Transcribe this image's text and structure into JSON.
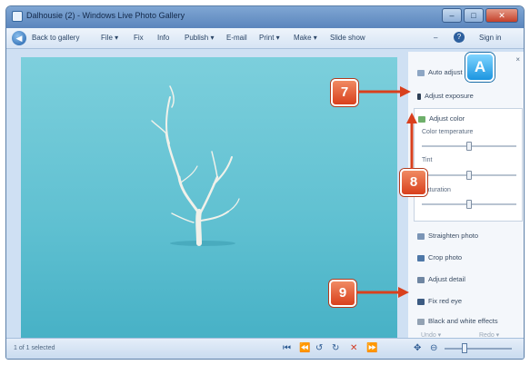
{
  "window": {
    "title": "Dalhousie (2) - Windows Live Photo Gallery",
    "controls": {
      "minimize": "–",
      "maximize": "□",
      "close": "✕"
    }
  },
  "menu": {
    "back_label": "Back to gallery",
    "items": [
      "File ▾",
      "Fix",
      "Info",
      "Publish ▾",
      "E-mail",
      "Print ▾",
      "Make ▾",
      "Slide show"
    ],
    "help": "?",
    "sign_in": "Sign in"
  },
  "panel": {
    "auto_adjust": "Auto adjust",
    "adjust_exposure": "Adjust exposure",
    "adjust_color": "Adjust color",
    "color_temperature": "Color temperature",
    "tint": "Tint",
    "saturation": "Saturation",
    "straighten": "Straighten photo",
    "crop": "Crop photo",
    "adjust_detail": "Adjust detail",
    "fix_redeye": "Fix red eye",
    "black_white": "Black and white effects",
    "undo": "Undo ▾",
    "redo": "Redo ▾"
  },
  "sliders": {
    "color_temperature": 0.5,
    "tint": 0.5,
    "saturation": 0.5
  },
  "status": {
    "text": "1 of 1 selected",
    "zoom_level": 0.3
  },
  "callouts": {
    "a": "A",
    "seven": "7",
    "eight": "8",
    "nine": "9"
  },
  "icons": {
    "back": "back-arrow-icon",
    "help": "help-icon",
    "first": "first-icon",
    "prev": "previous-icon",
    "rotate_left": "rotate-left-icon",
    "rotate_right": "rotate-right-icon",
    "delete": "delete-icon",
    "next": "next-icon"
  },
  "colors": {
    "accent_callout": "#d9401d",
    "callout_a": "#1b95e0",
    "water": "#6ec6d6"
  }
}
